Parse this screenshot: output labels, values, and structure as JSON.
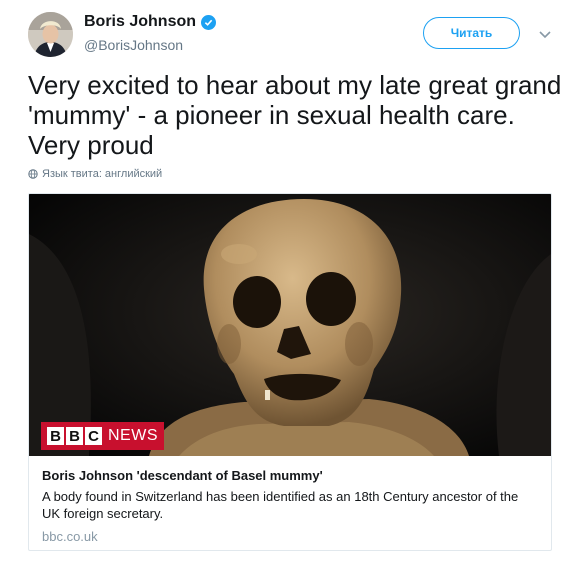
{
  "author": {
    "name": "Boris Johnson",
    "handle": "@BorisJohnson",
    "verified": true
  },
  "follow_button_label": "Читать",
  "tweet": {
    "text": "Very excited to hear about my late great grand 'mummy' - a pioneer in sexual health care. Very proud",
    "language_note": "Язык твита: английский"
  },
  "card": {
    "image_logo": {
      "left": "BBC",
      "right": "NEWS"
    },
    "title": "Boris Johnson 'descendant of Basel mummy'",
    "description": "A body found in Switzerland has been identified as an 18th Century ancestor of the UK foreign secretary.",
    "domain": "bbc.co.uk"
  },
  "icons": {
    "verified": "verified-badge-icon",
    "caret": "chevron-down-icon",
    "globe": "globe-icon"
  },
  "colors": {
    "accent": "#1da1f2",
    "text": "#14171a",
    "muted": "#657786",
    "bbc_red": "#c8102e"
  }
}
